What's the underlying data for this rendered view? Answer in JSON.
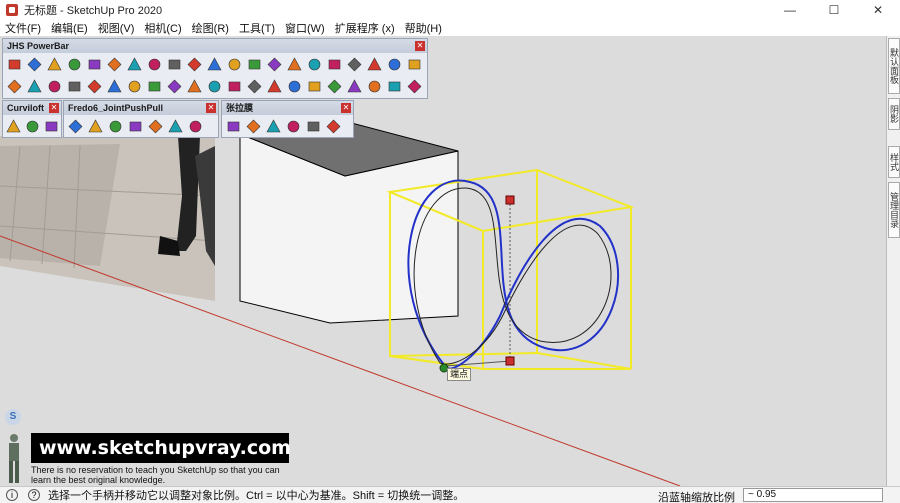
{
  "window": {
    "title": "无标题 - SketchUp Pro 2020",
    "minimize": "—",
    "maximize": "☐",
    "close": "✕"
  },
  "menu": [
    "文件(F)",
    "编辑(E)",
    "视图(V)",
    "相机(C)",
    "绘图(R)",
    "工具(T)",
    "窗口(W)",
    "扩展程序 (x)",
    "帮助(H)"
  ],
  "toolbars": {
    "jhs": {
      "title": "JHS PowerBar"
    },
    "curviloft": {
      "title": "Curviloft"
    },
    "fredo": {
      "title": "Fredo6_JointPushPull"
    },
    "zhang": {
      "title": "张拉膜"
    }
  },
  "right_tabs": [
    "默认面板",
    "阴影",
    "样式",
    "管理目录"
  ],
  "tooltip": {
    "endpoint": "端点"
  },
  "watermark": {
    "url": "www.sketchupvray.com",
    "caption": "There is no reservation to teach you SketchUp so that you can learn the best original knowledge.",
    "badge": "S"
  },
  "status": {
    "hint": "选择一个手柄并移动它以调整对象比例。Ctrl = 以中心为基准。Shift = 切换统一调整。",
    "measure_label": "沿蓝轴缩放比例",
    "measure_value": "~ 0.95"
  },
  "colors": {
    "viewport_bg": "#dcdcdc",
    "axis_red": "#c0392b",
    "bounding_box": "#f2ea27",
    "curve_blue": "#2232c8"
  }
}
